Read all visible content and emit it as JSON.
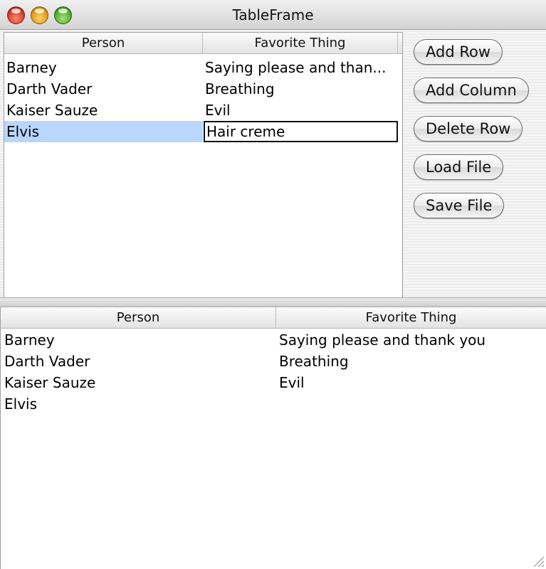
{
  "window": {
    "title": "TableFrame"
  },
  "top_table": {
    "columns": [
      "Person",
      "Favorite Thing"
    ],
    "rows": [
      [
        "Barney",
        "Saying please and than..."
      ],
      [
        "Darth Vader",
        "Breathing"
      ],
      [
        "Kaiser Sauze",
        "Evil"
      ],
      [
        "Elvis",
        "Hair creme"
      ]
    ],
    "selected_row": 3,
    "editing_value": "Hair creme"
  },
  "buttons": {
    "add_row": "Add Row",
    "add_column": "Add Column",
    "delete_row": "Delete Row",
    "load_file": "Load File",
    "save_file": "Save File"
  },
  "bottom_table": {
    "columns": [
      "Person",
      "Favorite Thing"
    ],
    "rows": [
      [
        "Barney",
        "Saying please and thank you"
      ],
      [
        "Darth Vader",
        "Breathing"
      ],
      [
        "Kaiser Sauze",
        "Evil"
      ],
      [
        "Elvis",
        ""
      ]
    ]
  },
  "colors": {
    "selection": "#b9d6ff",
    "close": "#d9361f",
    "minimize": "#e5a000",
    "zoom": "#47a91f"
  },
  "icons": [
    "close-window-icon",
    "minimize-window-icon",
    "zoom-window-icon",
    "resize-grip-icon"
  ]
}
